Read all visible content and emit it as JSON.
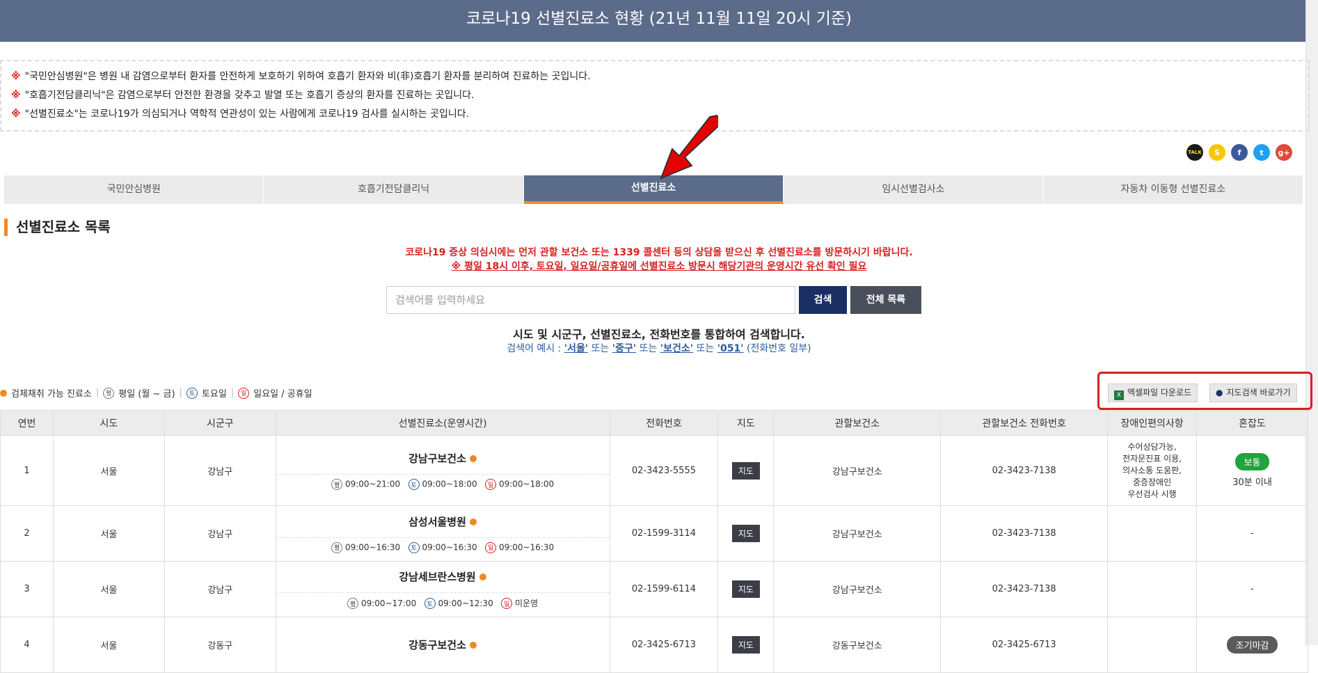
{
  "header": {
    "title": "코로나19 선별진료소 현황 (21년 11월 11일 20시 기준)"
  },
  "notices": [
    {
      "mark": "※",
      "text": "\"국민안심병원\"은 병원 내 감염으로부터 환자를 안전하게 보호하기 위하여 호흡기 환자와 비(非)호흡기 환자를 분리하여 진료하는 곳입니다."
    },
    {
      "mark": "※",
      "text": "\"호흡기전담클리닉\"은 감염으로부터 안전한 환경을 갖추고 발열 또는 호흡기 증상의 환자를 진료하는 곳입니다."
    },
    {
      "mark": "※",
      "text": "\"선별진료소\"는 코로나19가 의심되거나 역학적 연관성이 있는 사람에게 코로나19 검사를 실시하는 곳입니다."
    }
  ],
  "tabs": [
    "국민안심병원",
    "호흡기전담클리닉",
    "선별진료소",
    "임시선별검사소",
    "자동차 이동형 선별진료소"
  ],
  "section_title": "선별진료소 목록",
  "warning1": "코로나19 증상 의심시에는 먼저 관할 보건소 또는 1339 콜센터 등의 상담을 받으신 후 선별진료소를 방문하시기 바랍니다.",
  "warning2": "※ 평일 18시 이후, 토요일, 일요일/공휴일에 선별진료소 방문시 해당기관의 운영시간 유선 확인 필요",
  "search": {
    "placeholder": "검색어를 입력하세요",
    "search_label": "검색",
    "all_label": "전체 목록"
  },
  "hint1": "시도 및 시군구, 선별진료소, 전화번호를 통합하여 검색합니다.",
  "hint2": {
    "prefix": "검색어 예시 : ",
    "ex1": "'서울'",
    "or1": " 또는 ",
    "ex2": "'중구'",
    "or2": " 또는 ",
    "ex3": "'보건소'",
    "or3": " 또는 ",
    "ex4": "'051'",
    "suffix": " (전화번호 일부)"
  },
  "legend": {
    "sample": "검체채취 가능 진료소",
    "weekday_icon": "평",
    "weekday": "평일 (월 ~ 금)",
    "sat_icon": "토",
    "sat": "토요일",
    "sun_icon": "일",
    "sun": "일요일 / 공휴일",
    "sep": "|"
  },
  "tools": {
    "excel": "엑셀파일 다운로드",
    "map": "지도검색 바로가기"
  },
  "table": {
    "headers": [
      "연번",
      "시도",
      "시군구",
      "선별진료소(운영시간)",
      "전화번호",
      "지도",
      "관할보건소",
      "관할보건소 전화번호",
      "장애인편의사항",
      "혼잡도"
    ],
    "map_label": "지도",
    "rows": [
      {
        "no": "1",
        "sido": "서울",
        "sigungu": "강남구",
        "name": "강남구보건소",
        "wd": "09:00~21:00",
        "sat": "09:00~18:00",
        "sun": "09:00~18:00",
        "phone": "02-3423-5555",
        "health": "강남구보건소",
        "hphone": "02-3423-7138",
        "access": [
          "수어상담가능,",
          "전자문진표 이용,",
          "의사소통 도움판,",
          "중증장애인",
          "우선검사 시행"
        ],
        "crowd": "보통",
        "crowd_sub": "30분 이내"
      },
      {
        "no": "2",
        "sido": "서울",
        "sigungu": "강남구",
        "name": "삼성서울병원",
        "wd": "09:00~16:30",
        "sat": "09:00~16:30",
        "sun": "09:00~16:30",
        "phone": "02-1599-3114",
        "health": "강남구보건소",
        "hphone": "02-3423-7138",
        "crowd": "-"
      },
      {
        "no": "3",
        "sido": "서울",
        "sigungu": "강남구",
        "name": "강남세브란스병원",
        "wd": "09:00~17:00",
        "sat": "09:00~12:30",
        "sun": "미운영",
        "phone": "02-1599-6114",
        "health": "강남구보건소",
        "hphone": "02-3423-7138",
        "crowd": "-"
      },
      {
        "no": "4",
        "sido": "서울",
        "sigungu": "강동구",
        "name": "강동구보건소",
        "phone": "02-3425-6713",
        "health": "강동구보건소",
        "hphone": "02-3425-6713",
        "crowd": "조기마감"
      }
    ]
  },
  "share": [
    "TALK",
    "S",
    "f",
    "t",
    "g+"
  ],
  "colors": {
    "header": "#5b6b8a",
    "accent": "#f08a1e",
    "warn": "#d62020",
    "normal_badge": "#21a33d",
    "closed_badge": "#5a5a5a"
  }
}
